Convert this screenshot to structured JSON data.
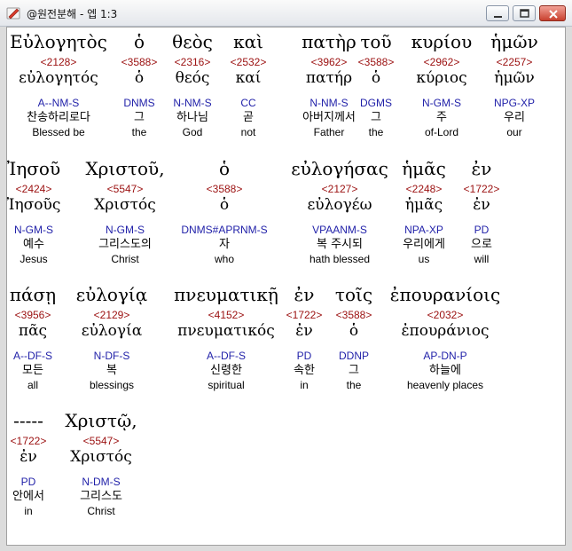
{
  "window": {
    "title": "@원전분해 - 엡 1:3",
    "icon": "app-bible-icon",
    "controls": [
      "minimize-icon",
      "maximize-icon",
      "close-icon"
    ]
  },
  "lines": [
    [
      {
        "greek": "Εὐλογητὸς",
        "strong": "<2128>",
        "lexeme": "εὐλογητός",
        "parsing": "A--NM-S",
        "korean": "찬송하리로다",
        "english": "Blessed be"
      },
      {
        "greek": "ὁ",
        "strong": "<3588>",
        "lexeme": "ὁ",
        "parsing": "DNMS",
        "korean": "그",
        "english": "the"
      },
      {
        "greek": "θεὸς",
        "strong": "<2316>",
        "lexeme": "θεός",
        "parsing": "N-NM-S",
        "korean": "하나님",
        "english": "God"
      },
      {
        "greek": "καὶ",
        "strong": "<2532>",
        "lexeme": "καί",
        "parsing": "CC",
        "korean": "곧",
        "english": "not"
      },
      {
        "greek": "πατὴρ",
        "strong": "<3962>",
        "lexeme": "πατήρ",
        "parsing": "N-NM-S",
        "korean": "아버지께서",
        "english": "Father"
      },
      {
        "greek": "τοῦ",
        "strong": "<3588>",
        "lexeme": "ὁ",
        "parsing": "DGMS",
        "korean": "그",
        "english": "the"
      },
      {
        "greek": "κυρίου",
        "strong": "<2962>",
        "lexeme": "κύριος",
        "parsing": "N-GM-S",
        "korean": "주",
        "english": "of-Lord"
      },
      {
        "greek": "ἡμῶν",
        "strong": "<2257>",
        "lexeme": "ἡμῶν",
        "parsing": "NPG-XP",
        "korean": "우리",
        "english": "our"
      }
    ],
    [
      {
        "greek": "Ἰησοῦ",
        "strong": "<2424>",
        "lexeme": "Ἰησοῦς",
        "parsing": "N-GM-S",
        "korean": "예수",
        "english": "Jesus"
      },
      {
        "greek": "Χριστοῦ,",
        "strong": "<5547>",
        "lexeme": "Χριστός",
        "parsing": "N-GM-S",
        "korean": "그리스도의",
        "english": "Christ"
      },
      {
        "greek": "ὁ",
        "strong": "<3588>",
        "lexeme": "ὁ",
        "parsing": "DNMS#APRNM-S",
        "korean": "자",
        "english": "who"
      },
      {
        "greek": "εὐλογήσας",
        "strong": "<2127>",
        "lexeme": "εὐλογέω",
        "parsing": "VPAANM-S",
        "korean": "복 주시되",
        "english": "hath blessed"
      },
      {
        "greek": "ἡμᾶς",
        "strong": "<2248>",
        "lexeme": "ἡμᾶς",
        "parsing": "NPA-XP",
        "korean": "우리에게",
        "english": "us"
      },
      {
        "greek": "ἐν",
        "strong": "<1722>",
        "lexeme": "ἐν",
        "parsing": "PD",
        "korean": "으로",
        "english": "will"
      }
    ],
    [
      {
        "greek": "πάσῃ",
        "strong": "<3956>",
        "lexeme": "πᾶς",
        "parsing": "A--DF-S",
        "korean": "모든",
        "english": "all"
      },
      {
        "greek": "εὐλογίᾳ",
        "strong": "<2129>",
        "lexeme": "εὐλογία",
        "parsing": "N-DF-S",
        "korean": "복",
        "english": "blessings"
      },
      {
        "greek": "πνευματικῇ",
        "strong": "<4152>",
        "lexeme": "πνευματικός",
        "parsing": "A--DF-S",
        "korean": "신령한",
        "english": "spiritual"
      },
      {
        "greek": "ἐν",
        "strong": "<1722>",
        "lexeme": "ἐν",
        "parsing": "PD",
        "korean": "속한",
        "english": "in"
      },
      {
        "greek": "τοῖς",
        "strong": "<3588>",
        "lexeme": "ὁ",
        "parsing": "DDNP",
        "korean": "그",
        "english": "the"
      },
      {
        "greek": "ἐπουρανίοις",
        "strong": "<2032>",
        "lexeme": "ἐπουράνιος",
        "parsing": "AP-DN-P",
        "korean": "하늘에",
        "english": "heavenly places"
      }
    ],
    [
      {
        "greek": "-----",
        "strong": "<1722>",
        "lexeme": "ἐν",
        "parsing": "PD",
        "korean": "안에서",
        "english": "in"
      },
      {
        "greek": "Χριστῷ,",
        "strong": "<5547>",
        "lexeme": "Χριστός",
        "parsing": "N-DM-S",
        "korean": "그리스도",
        "english": "Christ"
      }
    ]
  ]
}
